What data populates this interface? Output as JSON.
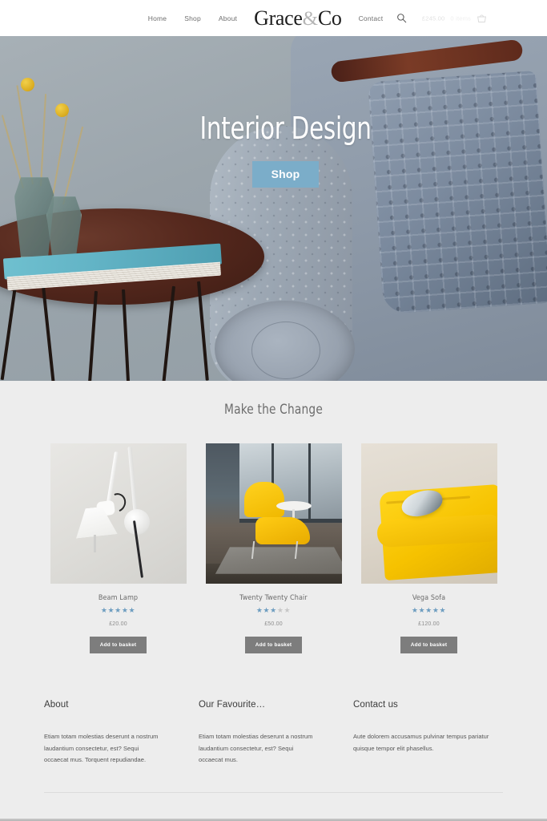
{
  "header": {
    "nav_left": [
      {
        "label": "Home",
        "name": "nav-home"
      },
      {
        "label": "Shop",
        "name": "nav-shop"
      },
      {
        "label": "About",
        "name": "nav-about"
      }
    ],
    "logo_main": "Grace",
    "logo_amp": "&",
    "logo_tail": "Co",
    "nav_right": [
      {
        "label": "Contact",
        "name": "nav-contact"
      }
    ],
    "search_icon": "search-icon",
    "cart": {
      "price": "£245.00",
      "count": "0 items",
      "icon": "basket-icon"
    }
  },
  "hero": {
    "title": "Interior Design",
    "button_label": "Shop",
    "button_color": "#7badc9"
  },
  "products_section": {
    "title": "Make the Change",
    "items": [
      {
        "name": "Beam Lamp",
        "rating": 5,
        "max_rating": 5,
        "price": "£20.00",
        "button_label": "Add to basket",
        "image_alt": "white wall lamp"
      },
      {
        "name": "Twenty Twenty Chair",
        "rating": 3,
        "max_rating": 5,
        "price": "£50.00",
        "button_label": "Add to basket",
        "image_alt": "yellow chairs by window"
      },
      {
        "name": "Vega Sofa",
        "rating": 5,
        "max_rating": 5,
        "price": "£120.00",
        "button_label": "Add to basket",
        "image_alt": "yellow sofa with cushion"
      }
    ],
    "star_on_color": "#6d9dc0",
    "star_off_color": "#c7c7c7",
    "button_color": "#7d7d7d"
  },
  "footer": {
    "columns": [
      {
        "heading": "About",
        "text": "Etiam totam molestias deserunt a nostrum laudantium consectetur, est? Sequi occaecat mus. Torquent repudiandae."
      },
      {
        "heading": "Our Favourite…",
        "text": "Etiam totam molestias deserunt a nostrum laudantium consectetur, est? Sequi occaecat mus."
      },
      {
        "heading": "Contact us",
        "text": "Aute dolorem accusamus pulvinar tempus pariatur quisque tempor elit phasellus."
      }
    ]
  }
}
